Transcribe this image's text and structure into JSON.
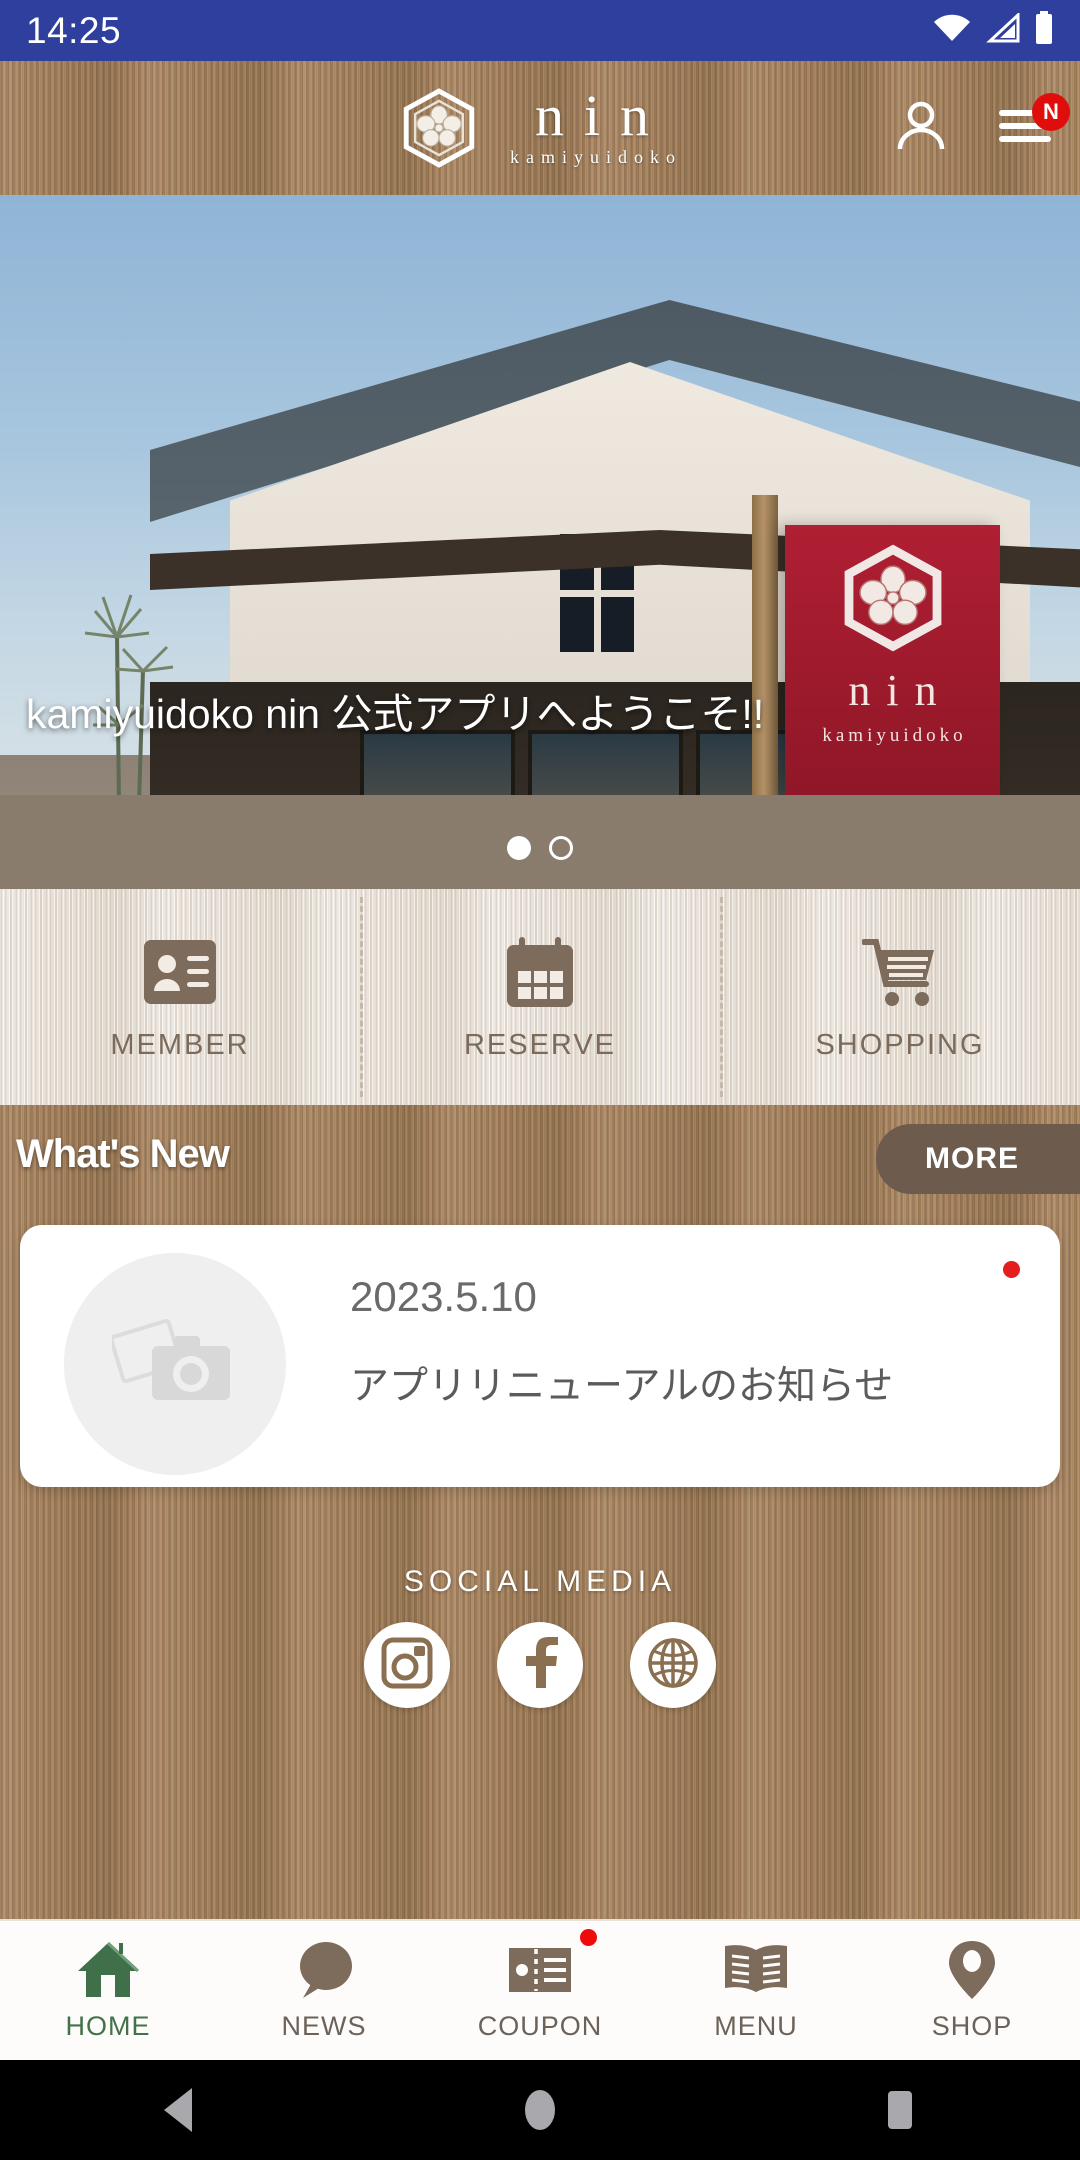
{
  "status_bar": {
    "time": "14:25",
    "background": "#2f3f9e",
    "icons": [
      "wifi-icon",
      "cellular-signal-icon",
      "battery-icon"
    ]
  },
  "header": {
    "logo_mark": "hexagon-flower-crest-icon",
    "brand": "nin",
    "brand_sub": "kamiyuidoko",
    "account_icon": "person-icon",
    "menu_icon": "hamburger-menu-icon",
    "menu_badge": "N",
    "badge_color": "#e00d0d"
  },
  "hero": {
    "caption": "kamiyuidoko nin 公式アプリへようこそ!!",
    "banner_brand": "nin",
    "banner_sub": "kamiyuidoko",
    "slide_count": 2,
    "active_slide": 1,
    "dots": [
      "active",
      "inactive"
    ]
  },
  "quick_actions": [
    {
      "label": "MEMBER",
      "icon": "id-card-icon"
    },
    {
      "label": "RESERVE",
      "icon": "calendar-icon"
    },
    {
      "label": "SHOPPING",
      "icon": "shopping-cart-icon"
    }
  ],
  "whats_new": {
    "title": "What's New",
    "more_label": "MORE",
    "more_button_color": "#6d5c4e",
    "items": [
      {
        "date": "2023.5.10",
        "title": "アプリリニューアルのお知らせ",
        "thumbnail_icon": "photo-camera-placeholder-icon",
        "unread": true,
        "unread_color": "#e41d1d"
      }
    ]
  },
  "social": {
    "label": "SOCIAL MEDIA",
    "links": [
      {
        "name": "instagram-icon"
      },
      {
        "name": "facebook-icon"
      },
      {
        "name": "website-globe-icon"
      }
    ]
  },
  "bottom_nav": {
    "active_color": "#43724a",
    "items": [
      {
        "label": "HOME",
        "icon": "home-icon",
        "active": true,
        "badge": false
      },
      {
        "label": "NEWS",
        "icon": "speech-bubble-icon",
        "active": false,
        "badge": false
      },
      {
        "label": "COUPON",
        "icon": "ticket-icon",
        "active": false,
        "badge": true
      },
      {
        "label": "MENU",
        "icon": "open-book-icon",
        "active": false,
        "badge": false
      },
      {
        "label": "SHOP",
        "icon": "map-pin-icon",
        "active": false,
        "badge": false
      }
    ]
  },
  "android_nav": {
    "back": "back-triangle-icon",
    "home": "home-circle-icon",
    "recents": "recents-square-icon"
  }
}
